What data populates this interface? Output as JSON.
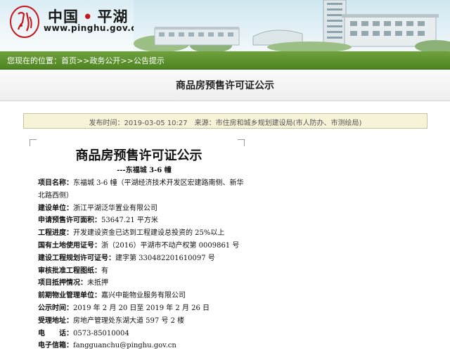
{
  "header": {
    "site_name_part1": "中国",
    "site_name_dot": "•",
    "site_name_part2": "平湖",
    "site_url": "www.pinghu.gov.cn"
  },
  "breadcrumb": {
    "prefix": "您现在的位置：",
    "items": [
      "首页",
      "政务公开",
      "公告提示"
    ],
    "separator": ">>"
  },
  "page": {
    "section_title": "商品房预售许可证公示"
  },
  "meta": {
    "text": "发布时间：2019-03-05 10:27　来源：市住房和城乡规划建设局(市人防办、市测绘局)"
  },
  "article": {
    "title": "商品房预售许可证公示",
    "subtitle": "---东福城 3-6 幢",
    "fields": [
      {
        "label": "项目名称：",
        "value": "东福城 3-6 幢（平湖经济技术开发区宏建路南侧、新华北路西侧）"
      },
      {
        "label": "建设单位：",
        "value": "浙江平湖泛华置业有限公司"
      },
      {
        "label": "申请预售许可面积：",
        "value": "53647.21 平方米"
      },
      {
        "label": "工程进度：",
        "value": "开发建设资金已达到工程建设总投资的 25%以上"
      },
      {
        "label": "国有土地使用证号：",
        "value": "浙（2016）平湖市不动产权第 0009861 号"
      },
      {
        "label": "建设工程规划许可证号：",
        "value": "建字第 330482201610097 号"
      },
      {
        "label": "审核批准工程图纸：",
        "value": "有"
      },
      {
        "label": "项目抵押情况：",
        "value": "未抵押"
      },
      {
        "label": "前期物业管理单位：",
        "value": "嘉兴中能物业服务有限公司"
      },
      {
        "label": "公示时间：",
        "value": "2019 年 2 月 20 日至 2019 年 2 月 26 日"
      },
      {
        "label": "受理地址：",
        "value": "房地产管理处东湖大道 597 号 2 楼"
      },
      {
        "label": "电　　话：",
        "value": "0573-85010004"
      },
      {
        "label": "电子信箱：",
        "value": "fangguanchu@pinghu.gov.cn"
      }
    ]
  },
  "colors": {
    "breadcrumb_bg": "#5a9129",
    "brand_red": "#c8161d",
    "meta_bg": "#f6f3d8"
  }
}
